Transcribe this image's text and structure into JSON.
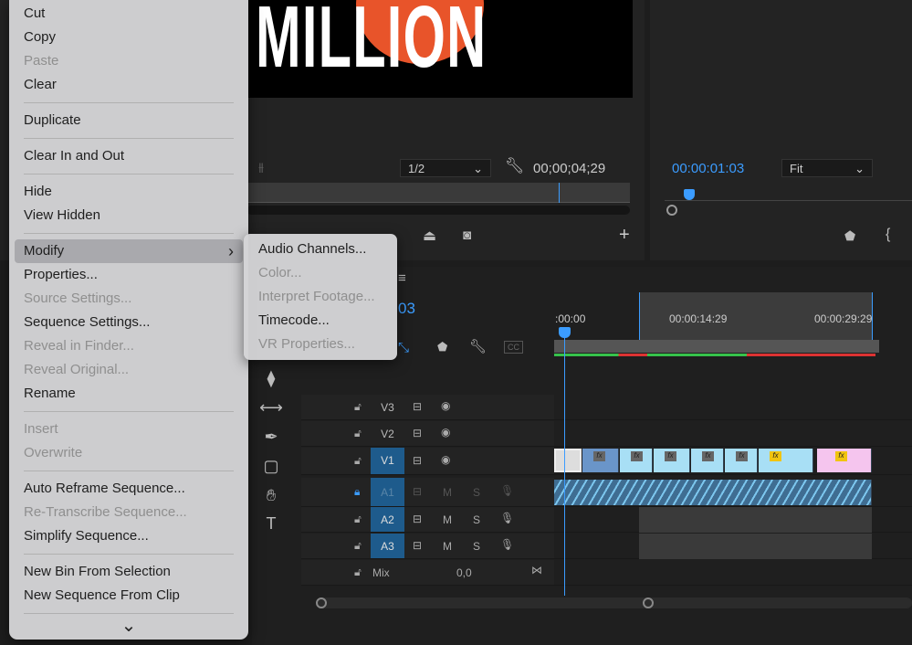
{
  "source_monitor": {
    "frame_text": "MILLION",
    "resolution": "1/2",
    "timecode": "00;00;04;29"
  },
  "program_monitor": {
    "timecode": "00:00:01:03",
    "zoom": "Fit"
  },
  "timeline": {
    "timecode_partial": "03",
    "ruler": [
      ":00:00",
      "00:00:14:29",
      "00:00:29:29"
    ],
    "tracks": [
      {
        "name": "V3",
        "type": "video"
      },
      {
        "name": "V2",
        "type": "video"
      },
      {
        "name": "V1",
        "type": "video",
        "targeted": true
      },
      {
        "name": "A1",
        "type": "audio",
        "locked": true
      },
      {
        "name": "A2",
        "type": "audio"
      },
      {
        "name": "A3",
        "type": "audio"
      }
    ],
    "mute_label": "M",
    "solo_label": "S",
    "mix": {
      "label": "Mix",
      "value": "0,0"
    },
    "fx_label": "fx"
  },
  "context_menu": {
    "groups": [
      [
        {
          "label": "Cut"
        },
        {
          "label": "Copy"
        },
        {
          "label": "Paste",
          "disabled": true
        },
        {
          "label": "Clear"
        }
      ],
      [
        {
          "label": "Duplicate"
        }
      ],
      [
        {
          "label": "Clear In and Out"
        }
      ],
      [
        {
          "label": "Hide"
        },
        {
          "label": "View Hidden"
        }
      ],
      [
        {
          "label": "Modify",
          "submenu": true,
          "highlighted": true
        },
        {
          "label": "Properties..."
        },
        {
          "label": "Source Settings...",
          "disabled": true
        },
        {
          "label": "Sequence Settings..."
        },
        {
          "label": "Reveal in Finder...",
          "disabled": true
        },
        {
          "label": "Reveal Original...",
          "disabled": true
        },
        {
          "label": "Rename"
        }
      ],
      [
        {
          "label": "Insert",
          "disabled": true
        },
        {
          "label": "Overwrite",
          "disabled": true
        }
      ],
      [
        {
          "label": "Auto Reframe Sequence..."
        },
        {
          "label": "Re-Transcribe Sequence...",
          "disabled": true
        },
        {
          "label": "Simplify Sequence..."
        }
      ],
      [
        {
          "label": "New Bin From Selection"
        },
        {
          "label": "New Sequence From Clip"
        }
      ]
    ],
    "more_icon": "chevron-down-icon"
  },
  "submenu": {
    "items": [
      {
        "label": "Audio Channels..."
      },
      {
        "label": "Color...",
        "disabled": true
      },
      {
        "label": "Interpret Footage...",
        "disabled": true
      },
      {
        "label": "Timecode..."
      },
      {
        "label": "VR Properties...",
        "disabled": true
      }
    ]
  },
  "colors": {
    "accent": "#3b9cff",
    "target": "#1e5b8c",
    "clip_video": "#a8dff5",
    "clip_pink": "#f5c5ee",
    "clip_audio": "#3f6d92"
  }
}
